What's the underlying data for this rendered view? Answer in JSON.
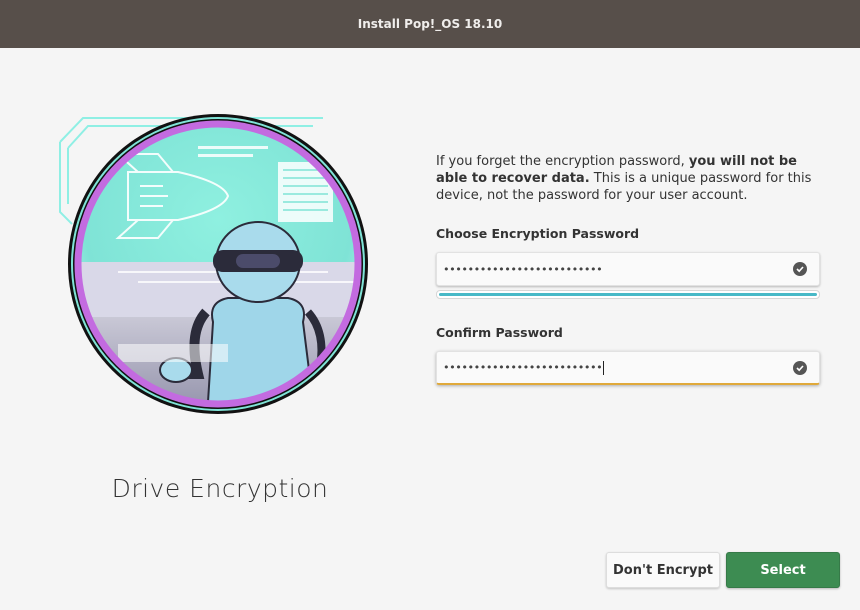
{
  "window": {
    "title": "Install Pop!_OS 18.10"
  },
  "page": {
    "heading": "Drive Encryption"
  },
  "description": {
    "text_before": "If you forget the encryption password, ",
    "text_bold": "you will not be able to recover data.",
    "text_after": " This is a unique password for this device, not the password for your user account."
  },
  "fields": {
    "encryption": {
      "label": "Choose Encryption Password",
      "value": "••••••••••••••••••••••••••",
      "valid_icon": "check-circle-icon",
      "strength": 1.0
    },
    "confirm": {
      "label": "Confirm Password",
      "value": "••••••••••••••••••••••••••",
      "valid_icon": "check-circle-icon"
    }
  },
  "buttons": {
    "dont_encrypt": "Don't Encrypt",
    "select": "Select"
  },
  "colors": {
    "titlebar": "#574f4a",
    "accent_teal": "#48b9c7",
    "focus_orange": "#e0a93a",
    "primary_green": "#3d8c52"
  }
}
